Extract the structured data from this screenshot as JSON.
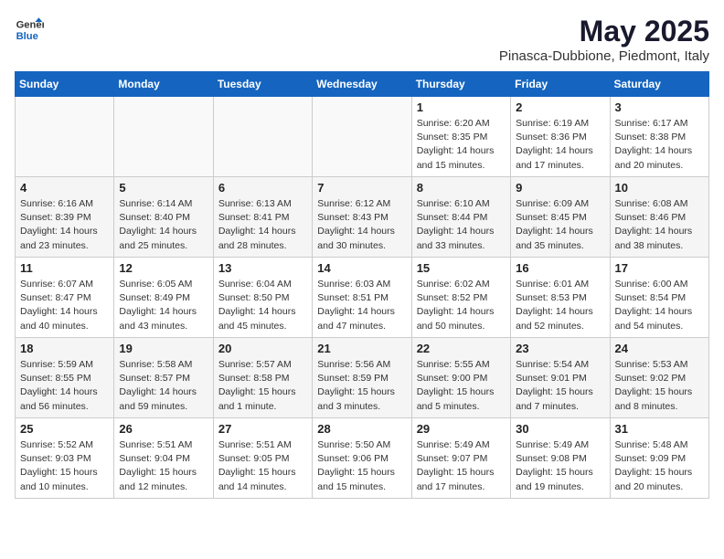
{
  "logo": {
    "line1": "General",
    "line2": "Blue"
  },
  "title": "May 2025",
  "location": "Pinasca-Dubbione, Piedmont, Italy",
  "days_of_week": [
    "Sunday",
    "Monday",
    "Tuesday",
    "Wednesday",
    "Thursday",
    "Friday",
    "Saturday"
  ],
  "weeks": [
    [
      {
        "day": "",
        "info": ""
      },
      {
        "day": "",
        "info": ""
      },
      {
        "day": "",
        "info": ""
      },
      {
        "day": "",
        "info": ""
      },
      {
        "day": "1",
        "info": "Sunrise: 6:20 AM\nSunset: 8:35 PM\nDaylight: 14 hours\nand 15 minutes."
      },
      {
        "day": "2",
        "info": "Sunrise: 6:19 AM\nSunset: 8:36 PM\nDaylight: 14 hours\nand 17 minutes."
      },
      {
        "day": "3",
        "info": "Sunrise: 6:17 AM\nSunset: 8:38 PM\nDaylight: 14 hours\nand 20 minutes."
      }
    ],
    [
      {
        "day": "4",
        "info": "Sunrise: 6:16 AM\nSunset: 8:39 PM\nDaylight: 14 hours\nand 23 minutes."
      },
      {
        "day": "5",
        "info": "Sunrise: 6:14 AM\nSunset: 8:40 PM\nDaylight: 14 hours\nand 25 minutes."
      },
      {
        "day": "6",
        "info": "Sunrise: 6:13 AM\nSunset: 8:41 PM\nDaylight: 14 hours\nand 28 minutes."
      },
      {
        "day": "7",
        "info": "Sunrise: 6:12 AM\nSunset: 8:43 PM\nDaylight: 14 hours\nand 30 minutes."
      },
      {
        "day": "8",
        "info": "Sunrise: 6:10 AM\nSunset: 8:44 PM\nDaylight: 14 hours\nand 33 minutes."
      },
      {
        "day": "9",
        "info": "Sunrise: 6:09 AM\nSunset: 8:45 PM\nDaylight: 14 hours\nand 35 minutes."
      },
      {
        "day": "10",
        "info": "Sunrise: 6:08 AM\nSunset: 8:46 PM\nDaylight: 14 hours\nand 38 minutes."
      }
    ],
    [
      {
        "day": "11",
        "info": "Sunrise: 6:07 AM\nSunset: 8:47 PM\nDaylight: 14 hours\nand 40 minutes."
      },
      {
        "day": "12",
        "info": "Sunrise: 6:05 AM\nSunset: 8:49 PM\nDaylight: 14 hours\nand 43 minutes."
      },
      {
        "day": "13",
        "info": "Sunrise: 6:04 AM\nSunset: 8:50 PM\nDaylight: 14 hours\nand 45 minutes."
      },
      {
        "day": "14",
        "info": "Sunrise: 6:03 AM\nSunset: 8:51 PM\nDaylight: 14 hours\nand 47 minutes."
      },
      {
        "day": "15",
        "info": "Sunrise: 6:02 AM\nSunset: 8:52 PM\nDaylight: 14 hours\nand 50 minutes."
      },
      {
        "day": "16",
        "info": "Sunrise: 6:01 AM\nSunset: 8:53 PM\nDaylight: 14 hours\nand 52 minutes."
      },
      {
        "day": "17",
        "info": "Sunrise: 6:00 AM\nSunset: 8:54 PM\nDaylight: 14 hours\nand 54 minutes."
      }
    ],
    [
      {
        "day": "18",
        "info": "Sunrise: 5:59 AM\nSunset: 8:55 PM\nDaylight: 14 hours\nand 56 minutes."
      },
      {
        "day": "19",
        "info": "Sunrise: 5:58 AM\nSunset: 8:57 PM\nDaylight: 14 hours\nand 59 minutes."
      },
      {
        "day": "20",
        "info": "Sunrise: 5:57 AM\nSunset: 8:58 PM\nDaylight: 15 hours\nand 1 minute."
      },
      {
        "day": "21",
        "info": "Sunrise: 5:56 AM\nSunset: 8:59 PM\nDaylight: 15 hours\nand 3 minutes."
      },
      {
        "day": "22",
        "info": "Sunrise: 5:55 AM\nSunset: 9:00 PM\nDaylight: 15 hours\nand 5 minutes."
      },
      {
        "day": "23",
        "info": "Sunrise: 5:54 AM\nSunset: 9:01 PM\nDaylight: 15 hours\nand 7 minutes."
      },
      {
        "day": "24",
        "info": "Sunrise: 5:53 AM\nSunset: 9:02 PM\nDaylight: 15 hours\nand 8 minutes."
      }
    ],
    [
      {
        "day": "25",
        "info": "Sunrise: 5:52 AM\nSunset: 9:03 PM\nDaylight: 15 hours\nand 10 minutes."
      },
      {
        "day": "26",
        "info": "Sunrise: 5:51 AM\nSunset: 9:04 PM\nDaylight: 15 hours\nand 12 minutes."
      },
      {
        "day": "27",
        "info": "Sunrise: 5:51 AM\nSunset: 9:05 PM\nDaylight: 15 hours\nand 14 minutes."
      },
      {
        "day": "28",
        "info": "Sunrise: 5:50 AM\nSunset: 9:06 PM\nDaylight: 15 hours\nand 15 minutes."
      },
      {
        "day": "29",
        "info": "Sunrise: 5:49 AM\nSunset: 9:07 PM\nDaylight: 15 hours\nand 17 minutes."
      },
      {
        "day": "30",
        "info": "Sunrise: 5:49 AM\nSunset: 9:08 PM\nDaylight: 15 hours\nand 19 minutes."
      },
      {
        "day": "31",
        "info": "Sunrise: 5:48 AM\nSunset: 9:09 PM\nDaylight: 15 hours\nand 20 minutes."
      }
    ]
  ]
}
